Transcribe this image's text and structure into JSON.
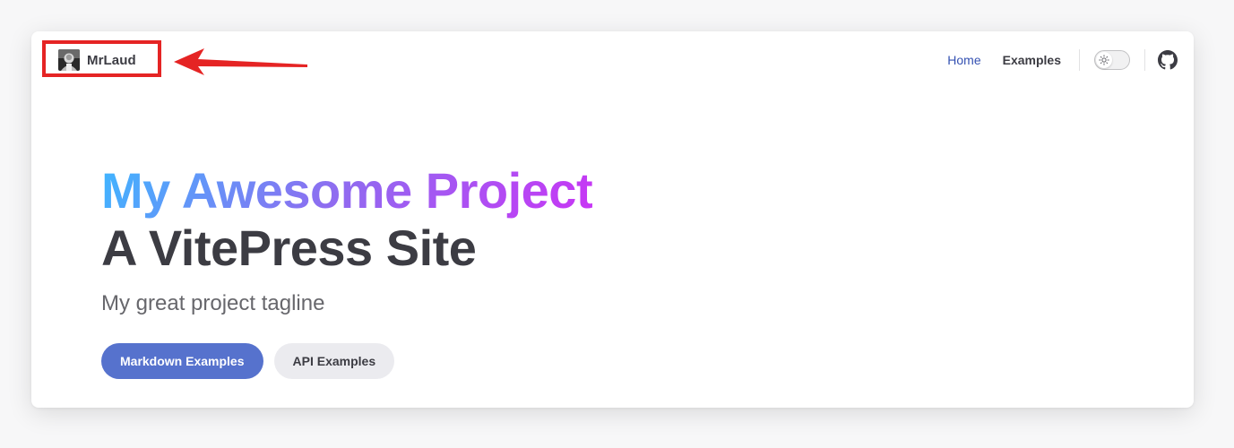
{
  "nav": {
    "site_title": "MrLaud",
    "links": [
      {
        "label": "Home",
        "active": true
      },
      {
        "label": "Examples",
        "active": false
      }
    ],
    "appearance_toggle": "sun-icon",
    "social": "github-icon"
  },
  "hero": {
    "name": "My Awesome Project",
    "text": "A VitePress Site",
    "tagline": "My great project tagline",
    "actions": [
      {
        "label": "Markdown Examples",
        "theme": "brand"
      },
      {
        "label": "API Examples",
        "theme": "alt"
      }
    ]
  },
  "colors": {
    "brand": "#5672cd",
    "active_link": "#3451b2",
    "annotation": "#e52424",
    "gradient_start": "#3fb6ff",
    "gradient_end": "#c935f5"
  }
}
